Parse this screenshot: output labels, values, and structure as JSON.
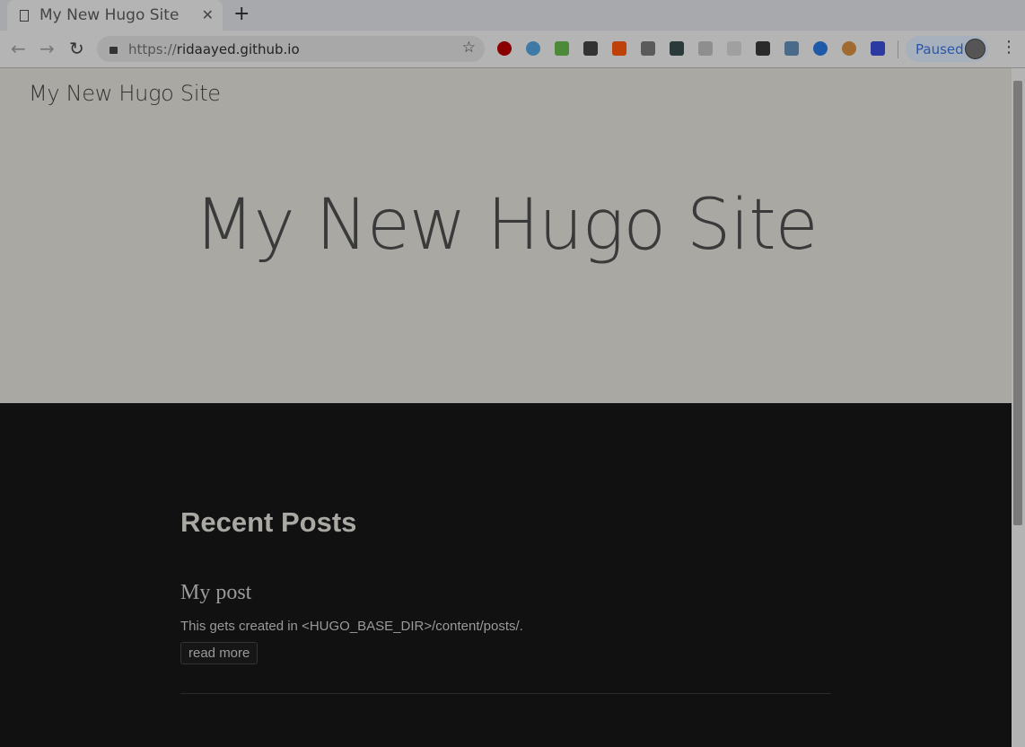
{
  "browser": {
    "tab_title": "My New Hugo Site",
    "url_scheme": "https://",
    "url_host": "ridaayed.github.io",
    "profile_status": "Paused",
    "extensions": [
      {
        "name": "adblock-plus-icon",
        "color": "#8a0000"
      },
      {
        "name": "vimium-icon",
        "color": "#3f7aa6"
      },
      {
        "name": "extension-green-icon",
        "color": "#4c8a3a"
      },
      {
        "name": "umbrella-icon",
        "color": "#333333"
      },
      {
        "name": "asterisk-icon",
        "color": "#c0400a"
      },
      {
        "name": "folder-icon",
        "color": "#5a5a5a"
      },
      {
        "name": "spy-icon",
        "color": "#2a3a3a"
      },
      {
        "name": "shield-icon",
        "color": "#8e8e8e"
      },
      {
        "name": "ghost-icon",
        "color": "#a0a0a0"
      },
      {
        "name": "keyboard-icon",
        "color": "#2a2a2a"
      },
      {
        "name": "magnifier-icon",
        "color": "#4a6a8a"
      },
      {
        "name": "lifebuoy-icon",
        "color": "#1e5aa8"
      },
      {
        "name": "cookie-icon",
        "color": "#a06a30"
      },
      {
        "name": "lighthouse-icon",
        "color": "#2a3aa0"
      }
    ]
  },
  "page": {
    "site_title": "My New Hugo Site",
    "hero_title": "My New Hugo Site",
    "section_heading": "Recent Posts",
    "posts": [
      {
        "title": "My post",
        "summary": "This gets created in <HUGO_BASE_DIR>/content/posts/.",
        "read_more": "read more"
      }
    ]
  }
}
